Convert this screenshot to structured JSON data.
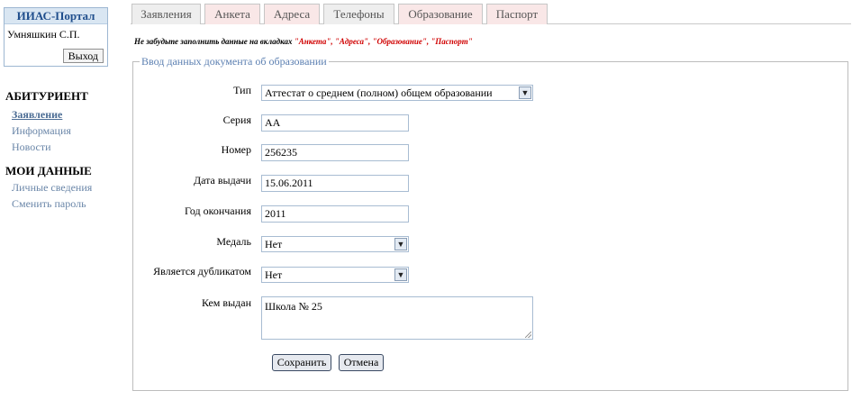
{
  "portal": {
    "title": "ИИАС-Портал",
    "user": "Умняшкин С.П.",
    "logout_label": "Выход"
  },
  "sidebar": {
    "sections": [
      {
        "title": "АБИТУРИЕНТ",
        "items": [
          "Заявление",
          "Информация",
          "Новости"
        ]
      },
      {
        "title": "МОИ ДАННЫЕ",
        "items": [
          "Личные сведения",
          "Сменить пароль"
        ]
      }
    ],
    "active_item": "Заявление"
  },
  "tabs": [
    "Заявления",
    "Анкета",
    "Адреса",
    "Телефоны",
    "Образование",
    "Паспорт"
  ],
  "note": {
    "prefix": "Не забудьте заполнить данные на вкладках ",
    "highlighted": "\"Анкета\", \"Адреса\", \"Образование\", \"Паспорт\""
  },
  "form": {
    "legend": "Ввод данных документа об образовании",
    "type_label": "Тип",
    "type_value": "Аттестат о среднем (полном) общем образовании",
    "series_label": "Серия",
    "series_value": "АА",
    "number_label": "Номер",
    "number_value": "256235",
    "issue_date_label": "Дата выдачи",
    "issue_date_value": "15.06.2011",
    "grad_year_label": "Год окончания",
    "grad_year_value": "2011",
    "medal_label": "Медаль",
    "medal_value": "Нет",
    "duplicate_label": "Является дубликатом",
    "duplicate_value": "Нет",
    "issued_by_label": "Кем выдан",
    "issued_by_value": "Школа № 25",
    "save_label": "Сохранить",
    "cancel_label": "Отмена"
  },
  "colors": {
    "link": "#6a86a8",
    "legend": "#5b7fb1",
    "highlight": "#d00000",
    "tab_pink": "#f9e7e7",
    "tab_grey": "#eeeeee"
  },
  "icons": {
    "select_arrow": "chevron-down-icon",
    "textarea_grip": "resize-grip-icon"
  }
}
